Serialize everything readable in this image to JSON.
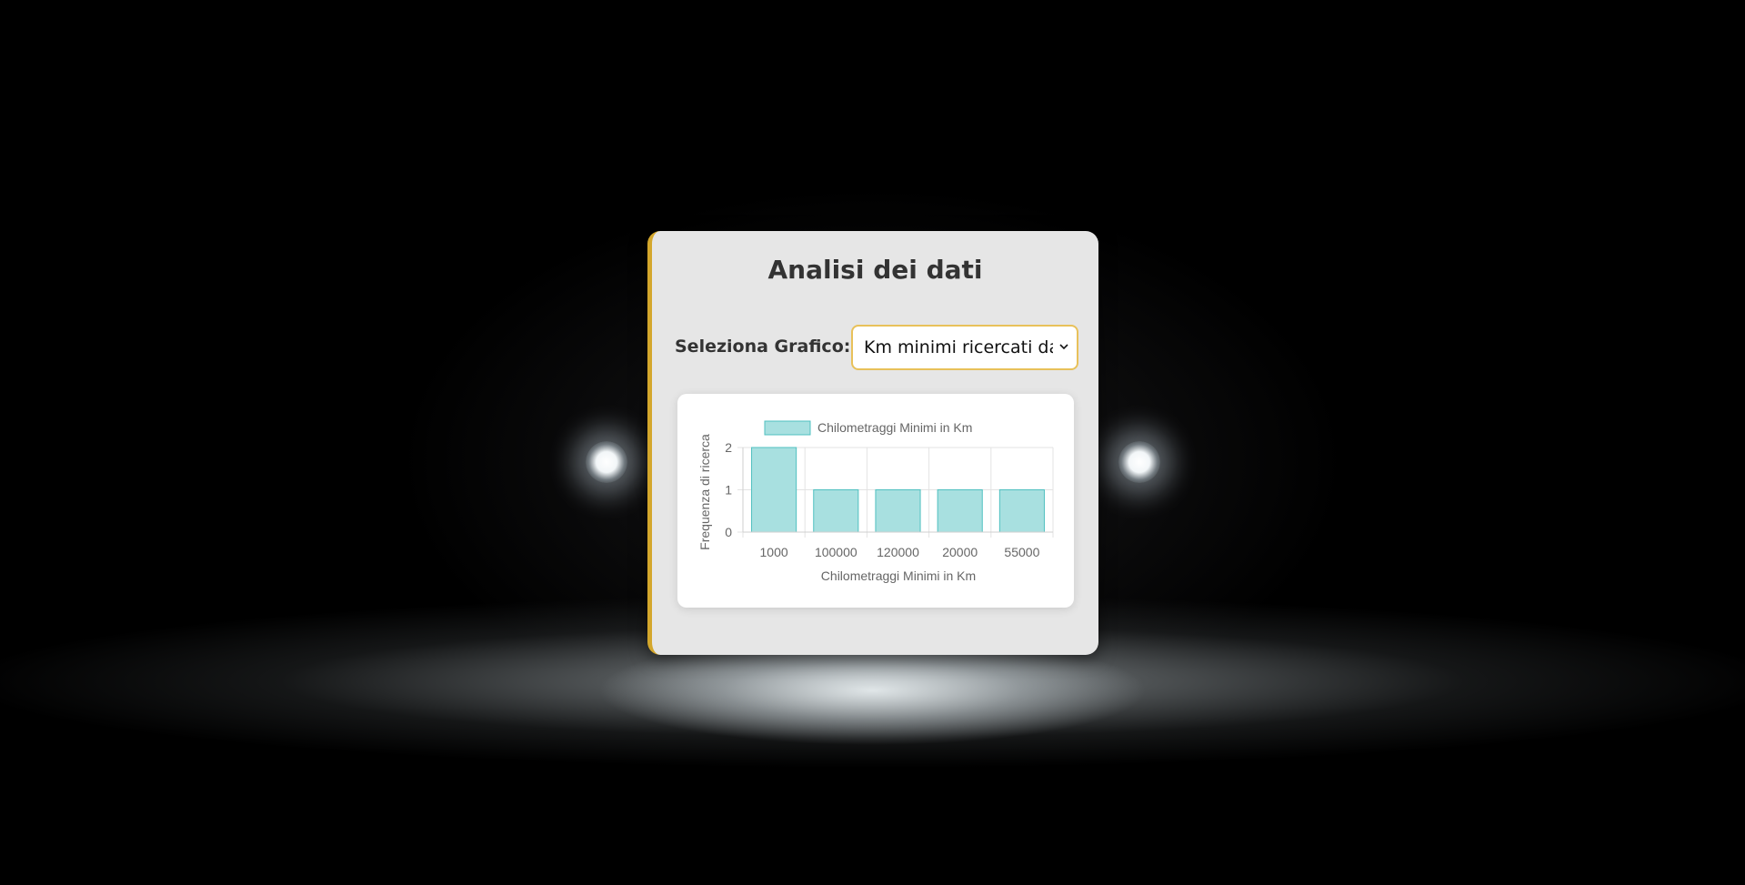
{
  "page": {
    "title": "Analisi dei dati",
    "select_label": "Seleziona Grafico:",
    "select_value": "Km minimi ricercati dagl",
    "select_icon": "chevron-down-icon"
  },
  "colors": {
    "accent": "#d4a72c",
    "bar_fill": "#a8e0e0",
    "bar_stroke": "#4fc0c0"
  },
  "chart_data": {
    "type": "bar",
    "categories": [
      "1000",
      "100000",
      "120000",
      "20000",
      "55000"
    ],
    "series": [
      {
        "name": "Chilometraggi Minimi in Km",
        "values": [
          2,
          1,
          1,
          1,
          1
        ]
      }
    ],
    "xlabel": "Chilometraggi Minimi in Km",
    "ylabel": "Frequenza di ricerca",
    "ylim": [
      0,
      2
    ],
    "yticks": [
      0,
      1,
      2
    ],
    "grid": true,
    "legend": "top"
  }
}
